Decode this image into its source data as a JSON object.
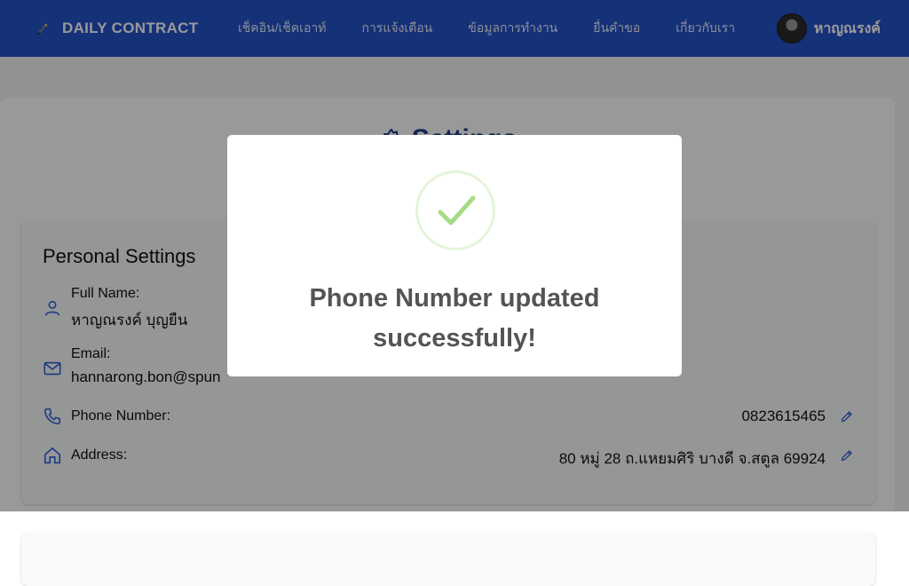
{
  "navbar": {
    "brand": "DAILY CONTRACT",
    "links": [
      "เช็คอิน/เช็คเอาท์",
      "การแจ้งเตือน",
      "ข้อมูลการทำงาน",
      "ยื่นคำขอ",
      "เกี่ยวกับเรา"
    ],
    "user_name": "หาญณรงค์"
  },
  "page": {
    "title": "Settings",
    "personal": {
      "title": "Personal Settings",
      "full_name_label": "Full Name:",
      "full_name_value": "หาญณรงค์ บุญยืน",
      "email_label": "Email:",
      "email_value": "hannarong.bon@spun",
      "phone_label": "Phone Number:",
      "phone_value": "0823615465",
      "address_label": "Address:",
      "address_value": "80 หมู่ 28 ถ.แหยมศิริ บางดี จ.สตูล 69924"
    }
  },
  "modal": {
    "message": "Phone Number updated successfully!"
  },
  "colors": {
    "navbar": "#2353c9",
    "title": "#1e3a8a",
    "icon": "#2b5fd9",
    "success": "#a5dc86",
    "overlay": "rgba(0,0,0,0.4)"
  },
  "icons": {
    "brand": "pencil-logo-icon",
    "title": "gear-icon",
    "full_name": "user-icon",
    "email": "mail-icon",
    "phone": "phone-icon",
    "address": "home-icon",
    "edit": "pencil-icon",
    "success": "checkmark-icon"
  }
}
